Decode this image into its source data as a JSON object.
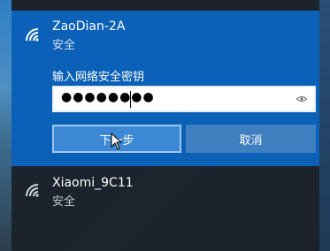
{
  "networks": [
    {
      "ssid": "ZaoDian-2A",
      "security": "安全",
      "icon": "wifi-signal-icon"
    },
    {
      "ssid": "Xiaomi_9C11",
      "security": "安全",
      "icon": "wifi-signal-icon"
    }
  ],
  "password": {
    "prompt": "输入网络安全密钥",
    "masked_value": "●●●●●●●●",
    "reveal_icon": "eye-icon"
  },
  "buttons": {
    "next": "下一步",
    "cancel": "取消"
  },
  "colors": {
    "selected_bg": "#0b61b8",
    "button_primary": "#3d88d4",
    "button_secondary": "#3f7fbf",
    "flyout_bg": "#1c2228"
  }
}
